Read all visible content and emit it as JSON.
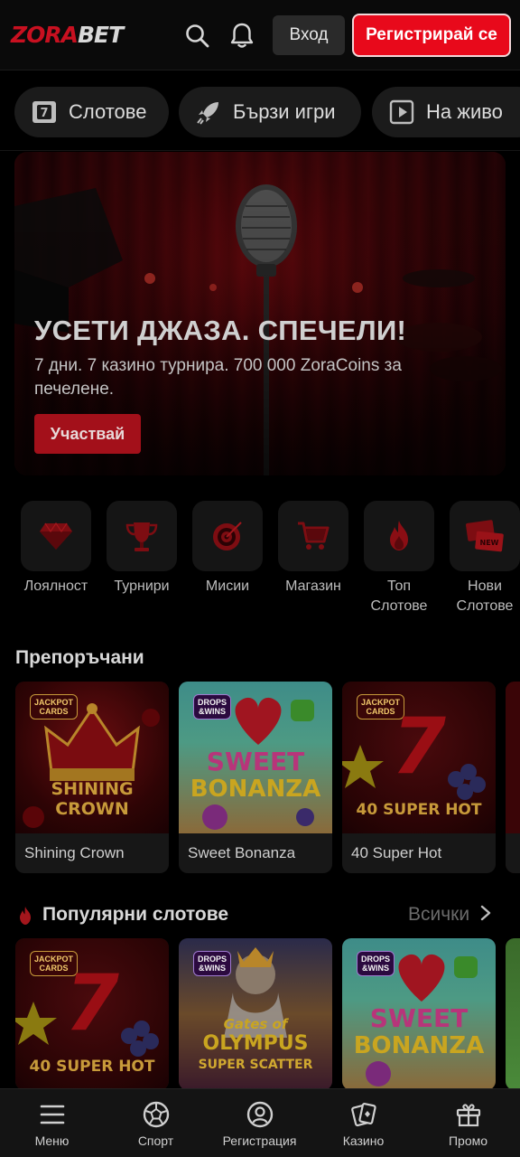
{
  "header": {
    "logo_part1": "ZORA",
    "logo_part2": "BET",
    "login_label": "Вход",
    "register_label": "Регистрирай се",
    "icons": [
      "search-icon",
      "bell-icon"
    ]
  },
  "categories": [
    {
      "label": "Слотове",
      "icon": "slot-seven-icon"
    },
    {
      "label": "Бързи игри",
      "icon": "rocket-icon"
    },
    {
      "label": "На живо",
      "icon": "play-icon"
    }
  ],
  "banner": {
    "title": "УСЕТИ ДЖАЗА. СПЕЧЕЛИ!",
    "subtitle": "7 дни. 7 казино турнира. 700 000 ZoraCoins за печелене.",
    "cta": "Участвай"
  },
  "quick_links": [
    {
      "label": "Лоялност",
      "icon": "diamond-icon"
    },
    {
      "label": "Турнири",
      "icon": "trophy-icon"
    },
    {
      "label": "Мисии",
      "icon": "target-icon"
    },
    {
      "label": "Магазин",
      "icon": "cart-icon"
    },
    {
      "label": "Топ Слотове",
      "icon": "flame-icon"
    },
    {
      "label": "Нови Слотове",
      "icon": "new-badge-icon"
    }
  ],
  "recommended": {
    "title": "Препоръчани",
    "games": [
      {
        "name": "Shining Crown",
        "art_line1": "SHINING",
        "art_line2": "CROWN",
        "badge_line1": "JACKPOT",
        "badge_line2": "CARDS"
      },
      {
        "name": "Sweet Bonanza",
        "art_line1": "SWEET",
        "art_line2": "BONANZA",
        "badge_line1": "DROPS",
        "badge_line2": "&WINS"
      },
      {
        "name": "40 Super Hot",
        "art_line1": "7",
        "art_line2": "40 SUPER HOT",
        "badge_line1": "JACKPOT",
        "badge_line2": "CARDS"
      }
    ]
  },
  "popular": {
    "title": "Популярни слотове",
    "all_label": "Всички",
    "games": [
      {
        "art_line1": "7",
        "art_line2": "40 SUPER HOT",
        "badge_line1": "JACKPOT",
        "badge_line2": "CARDS"
      },
      {
        "art_line1": "Gates of",
        "art_line2": "OLYMPUS",
        "art_line3": "SUPER SCATTER",
        "badge_line1": "DROPS",
        "badge_line2": "&WINS"
      },
      {
        "art_line1": "SWEET",
        "art_line2": "BONANZA",
        "badge_line1": "DROPS",
        "badge_line2": "&WINS"
      }
    ]
  },
  "bottom_nav": [
    {
      "label": "Меню",
      "icon": "hamburger-icon"
    },
    {
      "label": "Спорт",
      "icon": "soccer-ball-icon"
    },
    {
      "label": "Регистрация",
      "icon": "user-circle-icon"
    },
    {
      "label": "Казино",
      "icon": "cards-icon"
    },
    {
      "label": "Промо",
      "icon": "gift-icon"
    }
  ],
  "colors": {
    "brand_red": "#e8091b",
    "background": "#000000",
    "card_bg": "#171717"
  }
}
